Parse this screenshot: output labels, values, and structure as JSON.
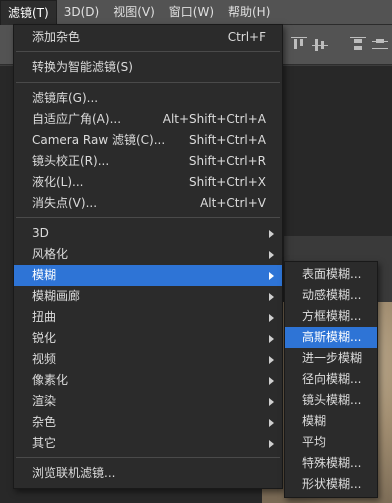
{
  "menubar": {
    "items": [
      "滤镜(T)",
      "3D(D)",
      "视图(V)",
      "窗口(W)",
      "帮助(H)"
    ]
  },
  "filter_menu": {
    "items": [
      {
        "label": "添加杂色",
        "shortcut": "Ctrl+F"
      },
      {
        "label": "转换为智能滤镜(S)"
      },
      {
        "label": "滤镜库(G)..."
      },
      {
        "label": "自适应广角(A)...",
        "shortcut": "Alt+Shift+Ctrl+A"
      },
      {
        "label": "Camera Raw 滤镜(C)...",
        "shortcut": "Shift+Ctrl+A"
      },
      {
        "label": "镜头校正(R)...",
        "shortcut": "Shift+Ctrl+R"
      },
      {
        "label": "液化(L)...",
        "shortcut": "Shift+Ctrl+X"
      },
      {
        "label": "消失点(V)...",
        "shortcut": "Alt+Ctrl+V"
      },
      {
        "label": "3D"
      },
      {
        "label": "风格化"
      },
      {
        "label": "模糊"
      },
      {
        "label": "模糊画廊"
      },
      {
        "label": "扭曲"
      },
      {
        "label": "锐化"
      },
      {
        "label": "视频"
      },
      {
        "label": "像素化"
      },
      {
        "label": "渲染"
      },
      {
        "label": "杂色"
      },
      {
        "label": "其它"
      },
      {
        "label": "浏览联机滤镜..."
      }
    ]
  },
  "blur_submenu": {
    "items": [
      "表面模糊...",
      "动感模糊...",
      "方框模糊...",
      "高斯模糊...",
      "进一步模糊",
      "径向模糊...",
      "镜头模糊...",
      "模糊",
      "平均",
      "特殊模糊...",
      "形状模糊..."
    ]
  },
  "colors": {
    "highlight": "#2e74d6",
    "menu_bg": "#2b2b2b",
    "menubar_bg": "#535353"
  }
}
